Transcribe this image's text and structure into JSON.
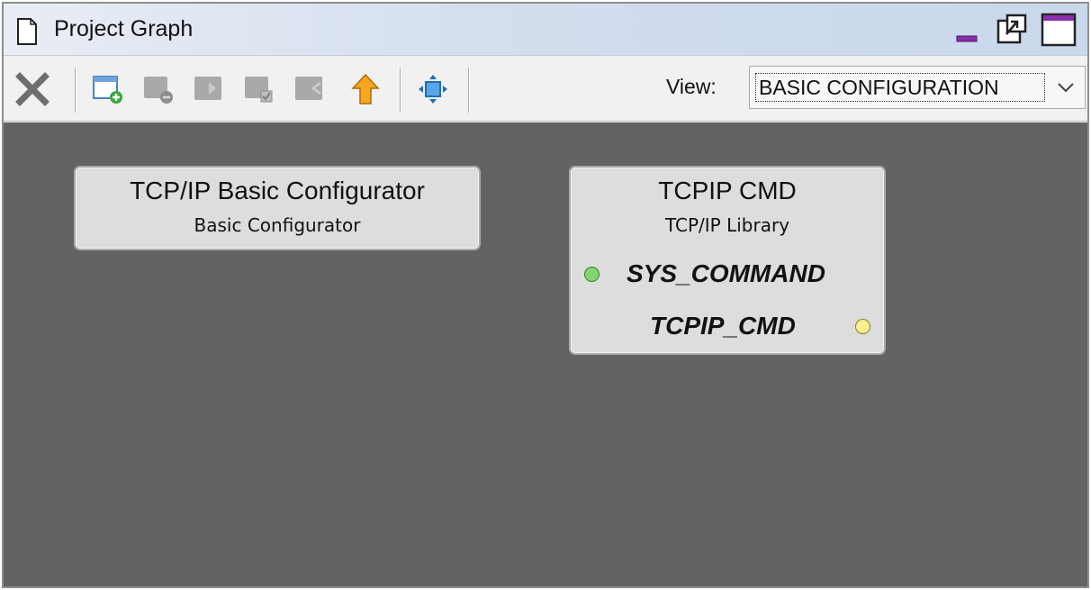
{
  "window": {
    "title": "Project Graph",
    "icons": {
      "document": "document-icon",
      "minimize": "minimize-icon",
      "restore": "restore-window-icon",
      "maximize": "maximize-icon"
    },
    "minimize_color": "#7a2fa0",
    "maximize_bar_color": "#7a2fa0"
  },
  "toolbar": {
    "buttons": [
      {
        "name": "delete",
        "icon": "delete-x-icon",
        "enabled": true
      },
      {
        "name": "new-group",
        "icon": "add-group-icon",
        "enabled": true
      },
      {
        "name": "remove-group",
        "icon": "remove-group-icon",
        "enabled": false
      },
      {
        "name": "move-in",
        "icon": "move-into-group-icon",
        "enabled": false
      },
      {
        "name": "group-check",
        "icon": "group-check-icon",
        "enabled": false
      },
      {
        "name": "move-out",
        "icon": "move-out-of-group-icon",
        "enabled": false
      },
      {
        "name": "go-up",
        "icon": "up-arrow-icon",
        "enabled": true
      },
      {
        "name": "fit-view",
        "icon": "fit-to-view-icon",
        "enabled": true
      }
    ],
    "view_label": "View:",
    "view_value": "BASIC CONFIGURATION",
    "arrow_icon": "chevron-down-icon"
  },
  "canvas": {
    "background": "#636363",
    "nodes": [
      {
        "title": "TCP/IP Basic Configurator",
        "subtitle": "Basic Configurator"
      },
      {
        "title": "TCPIP CMD",
        "subtitle": "TCP/IP Library",
        "ports": {
          "input": {
            "label": "SYS_COMMAND",
            "color": "#7fd66e"
          },
          "output": {
            "label": "TCPIP_CMD",
            "color": "#fbf08f"
          }
        }
      }
    ]
  }
}
